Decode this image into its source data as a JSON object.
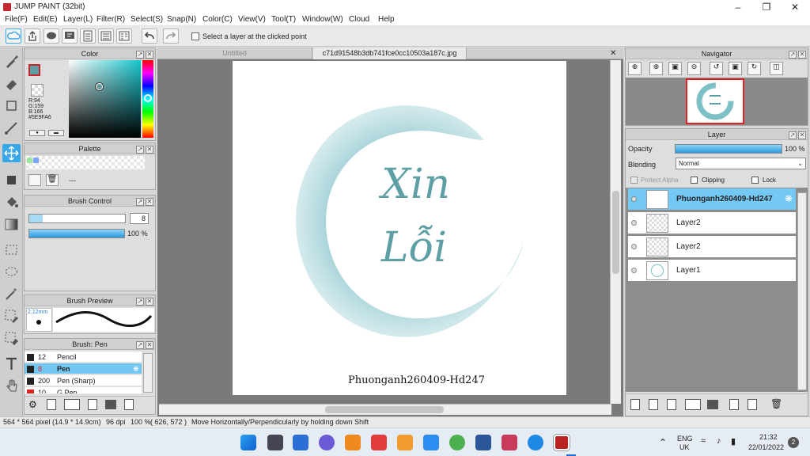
{
  "window": {
    "title": "JUMP PAINT (32bit)"
  },
  "menu": [
    "File(F)",
    "Edit(E)",
    "Layer(L)",
    "Filter(R)",
    "Select(S)",
    "Snap(N)",
    "Color(C)",
    "View(V)",
    "Tool(T)",
    "Window(W)",
    "Cloud",
    "Help"
  ],
  "toolbar": {
    "select_layer_label": "Select a layer at the clicked point"
  },
  "color_panel": {
    "title": "Color",
    "r": "R:94",
    "g": "G:159",
    "b": "B:166",
    "hex": "#5E9FA6"
  },
  "palette_panel": {
    "title": "Palette",
    "placeholder": "---"
  },
  "brush_control": {
    "title": "Brush Control",
    "size": "8",
    "opacity": "100 %"
  },
  "brush_preview": {
    "title": "Brush Preview",
    "size_label": "2.12mm"
  },
  "brush_list": {
    "title": "Brush: Pen",
    "items": [
      {
        "size": "12",
        "name": "Pencil"
      },
      {
        "size": "8",
        "name": "Pen"
      },
      {
        "size": "200",
        "name": "Pen (Sharp)"
      },
      {
        "size": "10",
        "name": "G Pen"
      }
    ]
  },
  "tabs": [
    "Untitled",
    "c71d91548b3db741fce0cc10503a187c.jpg"
  ],
  "canvas": {
    "line1": "Xin",
    "line2": "Lỗi",
    "caption": "Phuonganh260409-Hd247"
  },
  "navigator": {
    "title": "Navigator"
  },
  "layer_panel": {
    "title": "Layer",
    "opacity_label": "Opacity",
    "opacity_value": "100 %",
    "blending_label": "Blending",
    "blending_value": "Normal",
    "protect_alpha": "Protect Alpha",
    "clipping": "Clipping",
    "lock": "Lock",
    "layers": [
      "Phuonganh260409-Hd247",
      "Layer2",
      "Layer2",
      "Layer1"
    ]
  },
  "status": {
    "size": "564 * 564 pixel",
    "cm": "(14.9 * 14.9cm)",
    "dpi": "96 dpi",
    "zoom": "100 %",
    "coords": "( 626, 572 )",
    "hint": "Move Horizontally/Perpendicularly by holding down Shift"
  },
  "taskbar": {
    "lang1": "ENG",
    "lang2": "UK",
    "time": "21:32",
    "date": "22/01/2022",
    "badge": "2"
  },
  "colors": {
    "accent": "#37a7e8",
    "brush": "#5e9fa6",
    "selection": "#74c9f4"
  }
}
